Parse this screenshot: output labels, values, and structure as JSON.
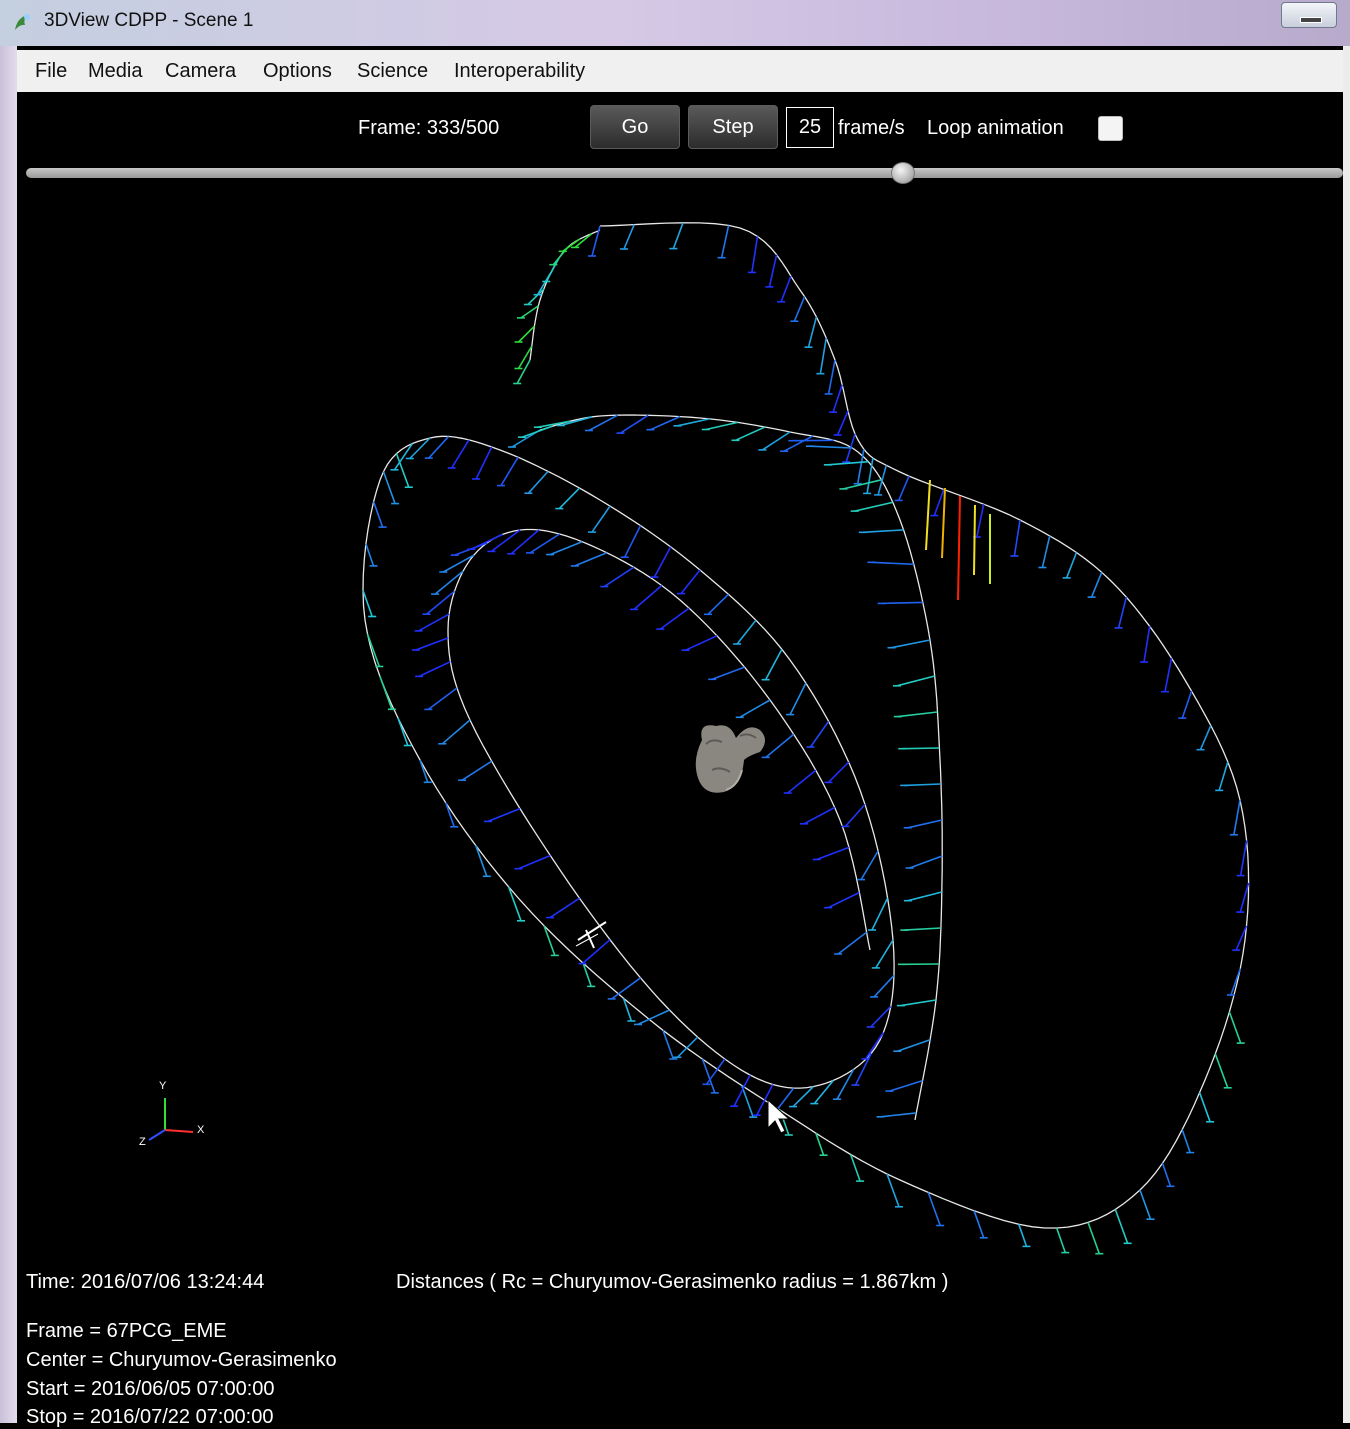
{
  "window": {
    "title": "3DView CDPP - Scene 1"
  },
  "menu": [
    "File",
    "Media",
    "Camera",
    "Options",
    "Science",
    "Interoperability"
  ],
  "toolbar": {
    "frame_label": "Frame: 333/500",
    "go_label": "Go",
    "step_label": "Step",
    "fps_value": "25",
    "fps_unit": "frame/s",
    "loop_label": "Loop animation",
    "loop_checked": false
  },
  "timeline": {
    "frame": 333,
    "total": 500,
    "position": 0.666
  },
  "info": {
    "time": "Time: 2016/07/06 13:24:44",
    "distances": "Distances ( Rc = Churyumov-Gerasimenko radius = 1.867km )",
    "frame": "Frame = 67PCG_EME",
    "center": "Center = Churyumov-Gerasimenko",
    "start": "Start = 2016/06/05 07:00:00",
    "stop": "Stop = 2016/07/22 07:00:00"
  },
  "axes": {
    "x": "X",
    "y": "Y",
    "z": "Z"
  },
  "colors": {
    "orbit": "#e8e8e8",
    "low": "#2030ff",
    "mid": "#20c8d8",
    "high": "#30e020",
    "peak": "#ff2000",
    "comet": "#8a8680"
  }
}
